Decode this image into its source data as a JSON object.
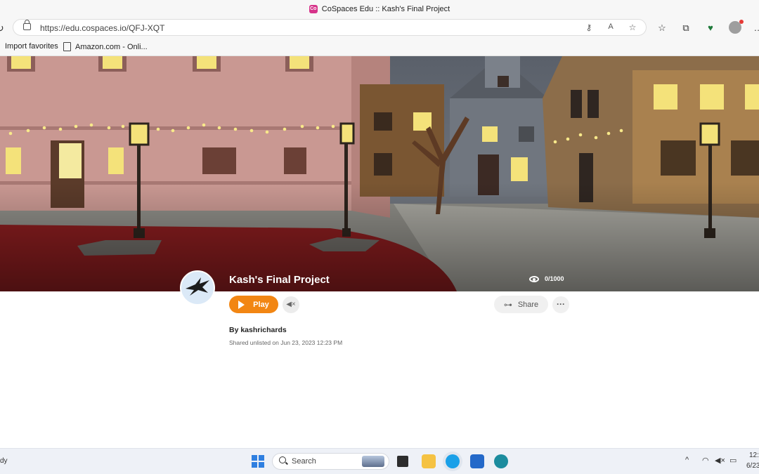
{
  "browser": {
    "window_title": "CoSpaces Edu :: Kash's Final Project",
    "favicon_text": "Co",
    "url": "https://edu.cospaces.io/QFJ-XQT",
    "favorites": [
      {
        "label": "Import favorites"
      },
      {
        "label": "Amazon.com - Onli..."
      }
    ]
  },
  "project": {
    "title": "Kash's Final Project",
    "views": "0/1000",
    "play_label": "Play",
    "share_label": "Share",
    "author": "By kashrichards",
    "shared_info": "Shared unlisted on Jun 23, 2023 12:23 PM"
  },
  "taskbar": {
    "status_left": "dy",
    "search_label": "Search",
    "clock_time": "12:",
    "clock_date": "6/23"
  },
  "colors": {
    "accent": "#f28613",
    "hero_ground": "#8a1d1f",
    "building_pink": "#c99892"
  }
}
